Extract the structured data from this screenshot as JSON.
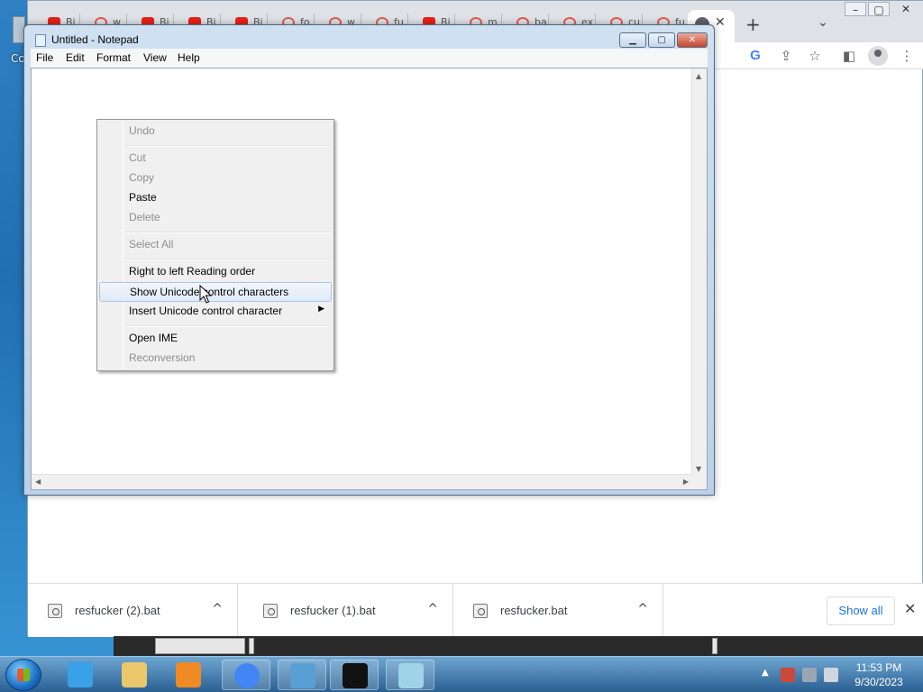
{
  "desktop": {
    "icon_label": "Co"
  },
  "chrome": {
    "tabs": [
      {
        "icon": "youtube-icon",
        "title": "Bi"
      },
      {
        "icon": "google-icon",
        "title": "w"
      },
      {
        "icon": "youtube-icon",
        "title": "Bi"
      },
      {
        "icon": "youtube-icon",
        "title": "Bi"
      },
      {
        "icon": "youtube-icon",
        "title": "Bi"
      },
      {
        "icon": "google-icon",
        "title": "fo"
      },
      {
        "icon": "google-icon",
        "title": "w"
      },
      {
        "icon": "google-icon",
        "title": "fu"
      },
      {
        "icon": "youtube-icon",
        "title": "Bi"
      },
      {
        "icon": "google-icon",
        "title": "m"
      },
      {
        "icon": "google-icon",
        "title": "ba"
      },
      {
        "icon": "google-icon",
        "title": "ex"
      },
      {
        "icon": "google-icon",
        "title": "cu"
      },
      {
        "icon": "google-icon",
        "title": "fu"
      }
    ],
    "active_tab_close": "✕",
    "new_tab": "+",
    "tab_search": "⌄",
    "toolbar": {
      "google_lens": "G",
      "share": "⇪",
      "bookmark": "☆",
      "side_panel": "◧",
      "menu": "⋮"
    },
    "window_controls": {
      "minimize": "–",
      "restore": "▢",
      "close": "✕"
    }
  },
  "downloads": {
    "items": [
      {
        "name": "resfucker (2).bat"
      },
      {
        "name": "resfucker (1).bat"
      },
      {
        "name": "resfucker.bat"
      }
    ],
    "show_all": "Show all",
    "close": "✕",
    "chevron": "^"
  },
  "notepad": {
    "title": "Untitled - Notepad",
    "menu": [
      "File",
      "Edit",
      "Format",
      "View",
      "Help"
    ],
    "buttons": {
      "minimize": "▁",
      "maximize": "▢",
      "close": "✕"
    }
  },
  "context_menu": {
    "items": [
      {
        "label": "Undo",
        "enabled": false
      },
      {
        "label": "Cut",
        "enabled": false
      },
      {
        "label": "Copy",
        "enabled": false
      },
      {
        "label": "Paste",
        "enabled": true
      },
      {
        "label": "Delete",
        "enabled": false
      },
      {
        "label": "Select All",
        "enabled": false
      },
      {
        "label": "Right to left Reading order",
        "enabled": true
      },
      {
        "label": "Show Unicode control characters",
        "enabled": true,
        "highlighted": true
      },
      {
        "label": "Insert Unicode control character",
        "enabled": true,
        "submenu": true
      },
      {
        "label": "Open IME",
        "enabled": true
      },
      {
        "label": "Reconversion",
        "enabled": false
      }
    ],
    "submenu_arrow": "▶"
  },
  "taskbar": {
    "apps": [
      {
        "name": "internet-explorer-icon",
        "color": "#3aa0e8"
      },
      {
        "name": "file-explorer-icon",
        "color": "#e9c76a"
      },
      {
        "name": "media-player-icon",
        "color": "#f08a24"
      },
      {
        "name": "chrome-icon",
        "color": "#4285f4"
      },
      {
        "name": "remote-desktop-icon",
        "color": "#5a9fd4"
      },
      {
        "name": "command-prompt-icon",
        "color": "#111111"
      },
      {
        "name": "notepad-icon",
        "color": "#9fd3e8"
      }
    ],
    "clock": {
      "time": "11:53 PM",
      "date": "9/30/2023"
    },
    "tray_arrow": "▲"
  }
}
